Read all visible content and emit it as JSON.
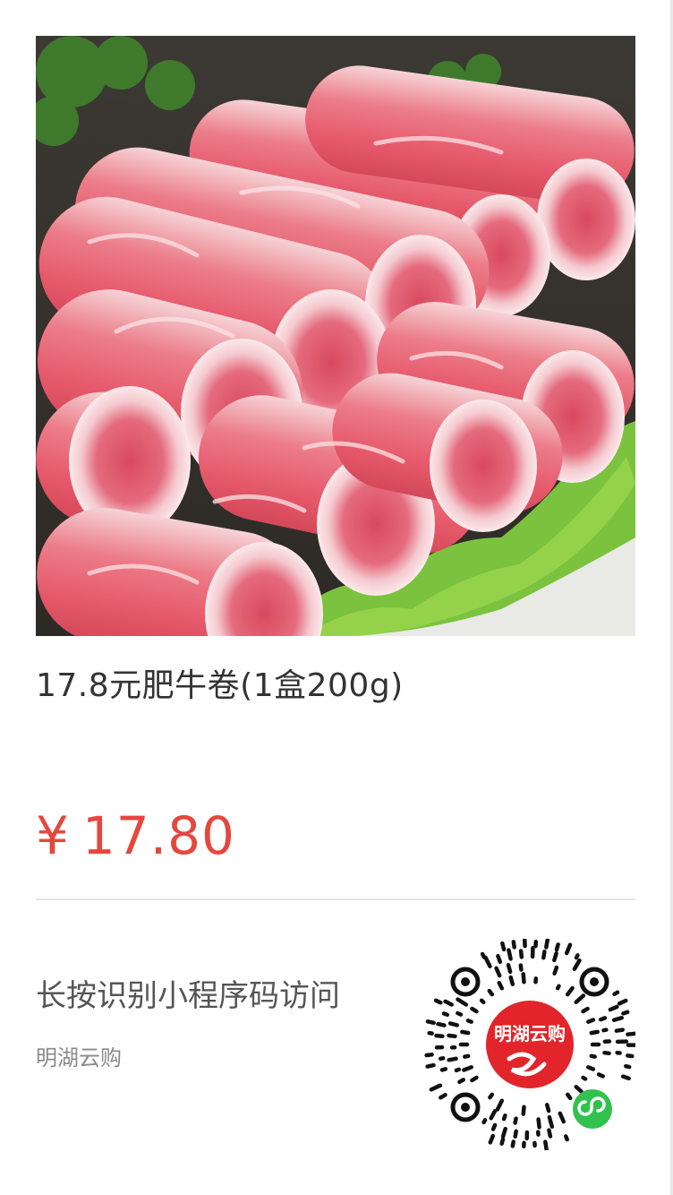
{
  "product": {
    "title": "17.8元肥牛卷(1盒200g)",
    "image_alt": "肥牛卷",
    "price": {
      "currency": "¥",
      "amount": "17.80"
    }
  },
  "share": {
    "instruction": "长按识别小程序码访问",
    "shop_name": "明湖云购",
    "code_label": "明湖云购"
  },
  "colors": {
    "price": "#e5473e",
    "code_badge": "#e1252b",
    "wechat_green": "#31c24d"
  },
  "icons": {
    "mini_program": "wechat-mini-program-icon"
  }
}
